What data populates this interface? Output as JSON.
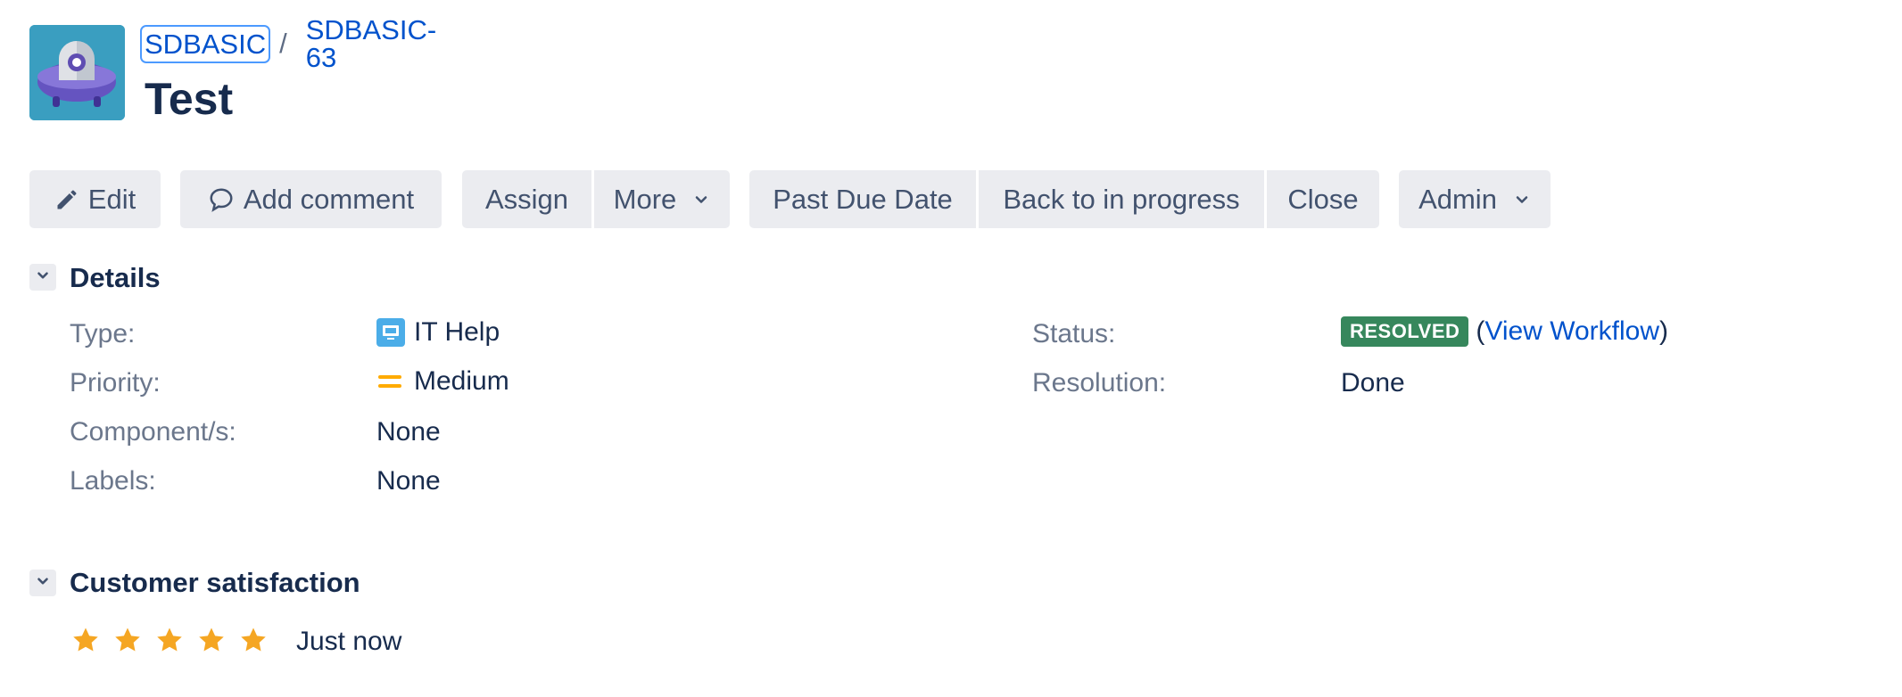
{
  "breadcrumb": {
    "project": "SDBASIC",
    "separator": "/",
    "issue_key": "SDBASIC-63"
  },
  "issue": {
    "title": "Test"
  },
  "toolbar": {
    "edit": "Edit",
    "add_comment": "Add comment",
    "assign": "Assign",
    "more": "More",
    "past_due_date": "Past Due Date",
    "back_to_in_progress": "Back to in progress",
    "close": "Close",
    "admin": "Admin"
  },
  "details": {
    "heading": "Details",
    "type_label": "Type:",
    "type_value": "IT Help",
    "priority_label": "Priority:",
    "priority_value": "Medium",
    "components_label": "Component/s:",
    "components_value": "None",
    "labels_label": "Labels:",
    "labels_value": "None",
    "status_label": "Status:",
    "status_value": "RESOLVED",
    "view_workflow_open": "(",
    "view_workflow": "View Workflow",
    "view_workflow_close": ")",
    "resolution_label": "Resolution:",
    "resolution_value": "Done"
  },
  "satisfaction": {
    "heading": "Customer satisfaction",
    "rating": 5,
    "rating_max": 5,
    "time": "Just now"
  },
  "colors": {
    "link": "#0052cc",
    "resolved_lozenge": "#36875c",
    "star": "#f5a623",
    "priority_medium": "#ffab00",
    "button_bg": "#ebecf0"
  },
  "icons": {
    "project_avatar": "project-avatar-icon",
    "edit": "pencil-icon",
    "comment": "comment-icon",
    "chevron": "chevron-down-icon",
    "type": "it-help-icon",
    "priority": "priority-medium-icon",
    "star": "star-icon"
  }
}
